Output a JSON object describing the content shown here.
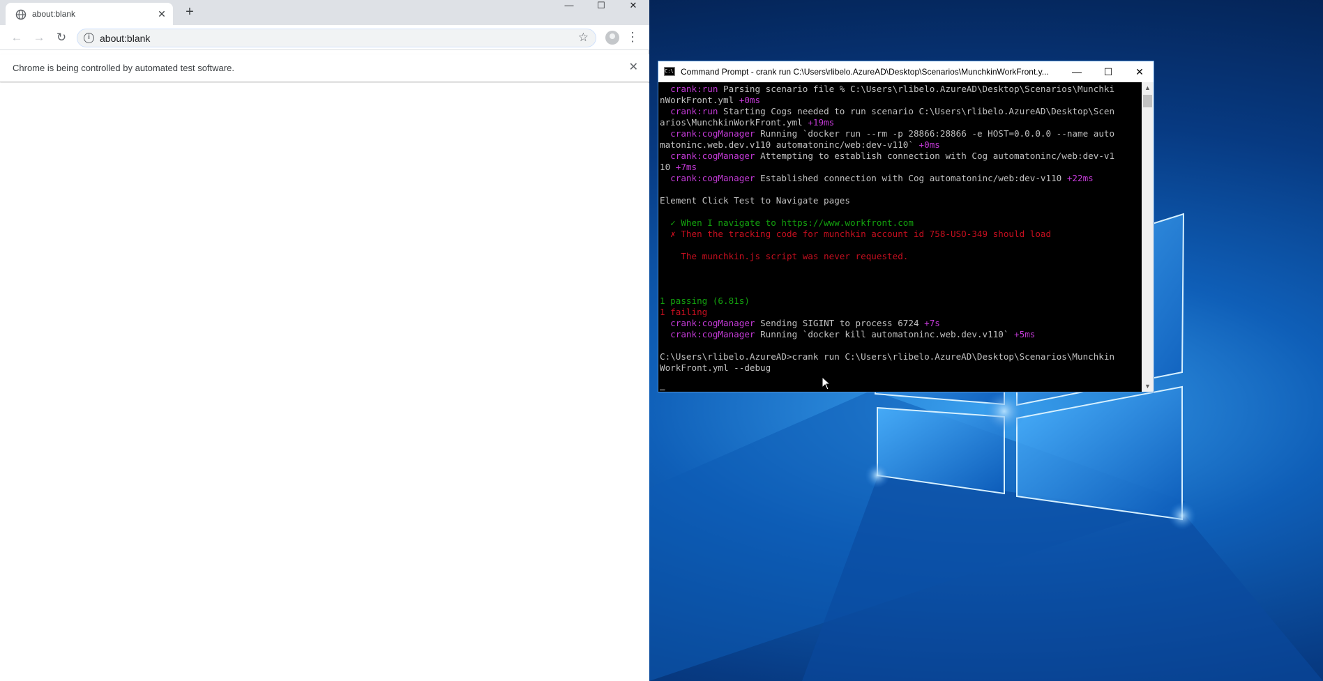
{
  "browser": {
    "tab_title": "about:blank",
    "new_tab_label": "+",
    "url": "about:blank",
    "infobar_message": "Chrome is being controlled by automated test software.",
    "window_buttons": {
      "minimize": "—",
      "maximize": "☐",
      "close": "✕"
    },
    "icons": {
      "tab_favicon": "globe-icon",
      "back": "back-arrow-icon",
      "forward": "forward-arrow-icon",
      "reload": "reload-icon",
      "site_info": "info-icon",
      "bookmark": "star-icon",
      "profile": "avatar-icon",
      "menu": "kebab-menu-icon"
    }
  },
  "terminal": {
    "title": "Command Prompt - crank  run C:\\Users\\rlibelo.AzureAD\\Desktop\\Scenarios\\MunchkinWorkFront.y...",
    "window_buttons": {
      "minimize": "—",
      "maximize": "☐",
      "close": "✕"
    },
    "lines": [
      [
        {
          "t": "  "
        },
        {
          "t": "crank:run",
          "c": "mag"
        },
        {
          "t": " Parsing scenario file % C:\\Users\\rlibelo.AzureAD\\Desktop\\Scenarios\\Munchki"
        }
      ],
      [
        {
          "t": "nWorkFront.yml "
        },
        {
          "t": "+0ms",
          "c": "mag"
        }
      ],
      [
        {
          "t": "  "
        },
        {
          "t": "crank:run",
          "c": "mag"
        },
        {
          "t": " Starting Cogs needed to run scenario C:\\Users\\rlibelo.AzureAD\\Desktop\\Scen"
        }
      ],
      [
        {
          "t": "arios\\MunchkinWorkFront.yml "
        },
        {
          "t": "+19ms",
          "c": "mag"
        }
      ],
      [
        {
          "t": "  "
        },
        {
          "t": "crank:cogManager",
          "c": "mag"
        },
        {
          "t": " Running `docker run --rm -p 28866:28866 -e HOST=0.0.0.0 --name auto"
        }
      ],
      [
        {
          "t": "matoninc.web.dev.v110 automatoninc/web:dev-v110` "
        },
        {
          "t": "+0ms",
          "c": "mag"
        }
      ],
      [
        {
          "t": "  "
        },
        {
          "t": "crank:cogManager",
          "c": "mag"
        },
        {
          "t": " Attempting to establish connection with Cog automatoninc/web:dev-v1"
        }
      ],
      [
        {
          "t": "10 "
        },
        {
          "t": "+7ms",
          "c": "mag"
        }
      ],
      [
        {
          "t": "  "
        },
        {
          "t": "crank:cogManager",
          "c": "mag"
        },
        {
          "t": " Established connection with Cog automatoninc/web:dev-v110 "
        },
        {
          "t": "+22ms",
          "c": "mag"
        }
      ],
      [
        {
          "t": ""
        }
      ],
      [
        {
          "t": "Element Click Test to Navigate pages"
        }
      ],
      [
        {
          "t": ""
        }
      ],
      [
        {
          "t": "  ✓ When I navigate to https://www.workfront.com",
          "c": "green"
        }
      ],
      [
        {
          "t": "  ✗ Then the tracking code for munchkin account id 758-USO-349 should load",
          "c": "red"
        }
      ],
      [
        {
          "t": ""
        }
      ],
      [
        {
          "t": "    The munchkin.js script was never requested.",
          "c": "red"
        }
      ],
      [
        {
          "t": ""
        }
      ],
      [
        {
          "t": ""
        }
      ],
      [
        {
          "t": ""
        }
      ],
      [
        {
          "t": "1 passing (6.81s)",
          "c": "green"
        }
      ],
      [
        {
          "t": "1 failing",
          "c": "red"
        }
      ],
      [
        {
          "t": "  "
        },
        {
          "t": "crank:cogManager",
          "c": "mag"
        },
        {
          "t": " Sending SIGINT to process 6724 "
        },
        {
          "t": "+7s",
          "c": "mag"
        }
      ],
      [
        {
          "t": "  "
        },
        {
          "t": "crank:cogManager",
          "c": "mag"
        },
        {
          "t": " Running `docker kill automatoninc.web.dev.v110` "
        },
        {
          "t": "+5ms",
          "c": "mag"
        }
      ],
      [
        {
          "t": ""
        }
      ],
      [
        {
          "t": "C:\\Users\\rlibelo.AzureAD>crank run C:\\Users\\rlibelo.AzureAD\\Desktop\\Scenarios\\Munchkin"
        }
      ],
      [
        {
          "t": "WorkFront.yml --debug"
        }
      ],
      [
        {
          "t": ""
        }
      ],
      [
        {
          "t": "▬"
        }
      ]
    ]
  },
  "desktop": {
    "wallpaper": "windows-10-logo",
    "colors": {
      "deep": "#04204f",
      "mid": "#0f5fb8",
      "light": "#3aa0ee"
    }
  }
}
